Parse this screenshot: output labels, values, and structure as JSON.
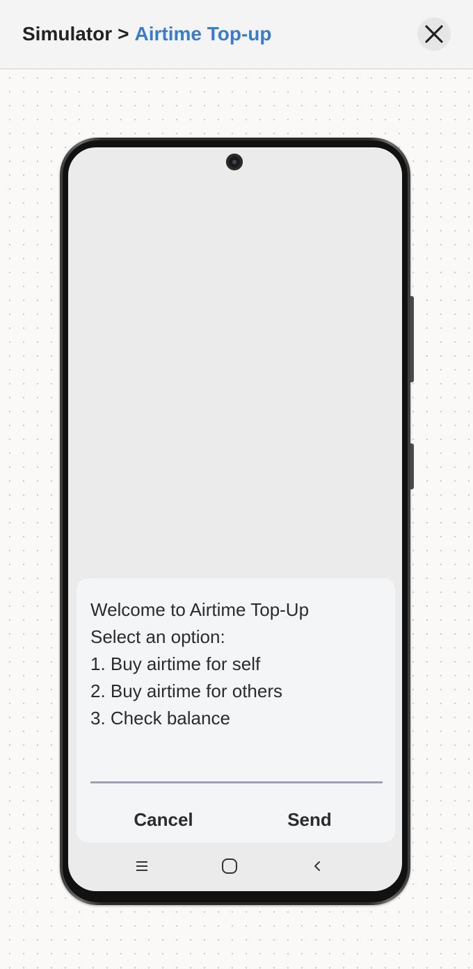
{
  "header": {
    "breadcrumb_root": "Simulator",
    "breadcrumb_separator": ">",
    "breadcrumb_current": "Airtime Top-up",
    "close_icon": "close-icon"
  },
  "colors": {
    "accent": "#3b7bc8",
    "text": "#222222"
  },
  "phone": {
    "dialog": {
      "lines": [
        "Welcome to Airtime Top-Up",
        "Select an option:",
        "1. Buy airtime for self",
        "2. Buy airtime for others",
        "3. Check balance"
      ],
      "input_value": "",
      "cancel_label": "Cancel",
      "send_label": "Send"
    },
    "navbar": {
      "menu_icon": "menu-icon",
      "home_icon": "home-icon",
      "back_icon": "back-icon"
    }
  }
}
